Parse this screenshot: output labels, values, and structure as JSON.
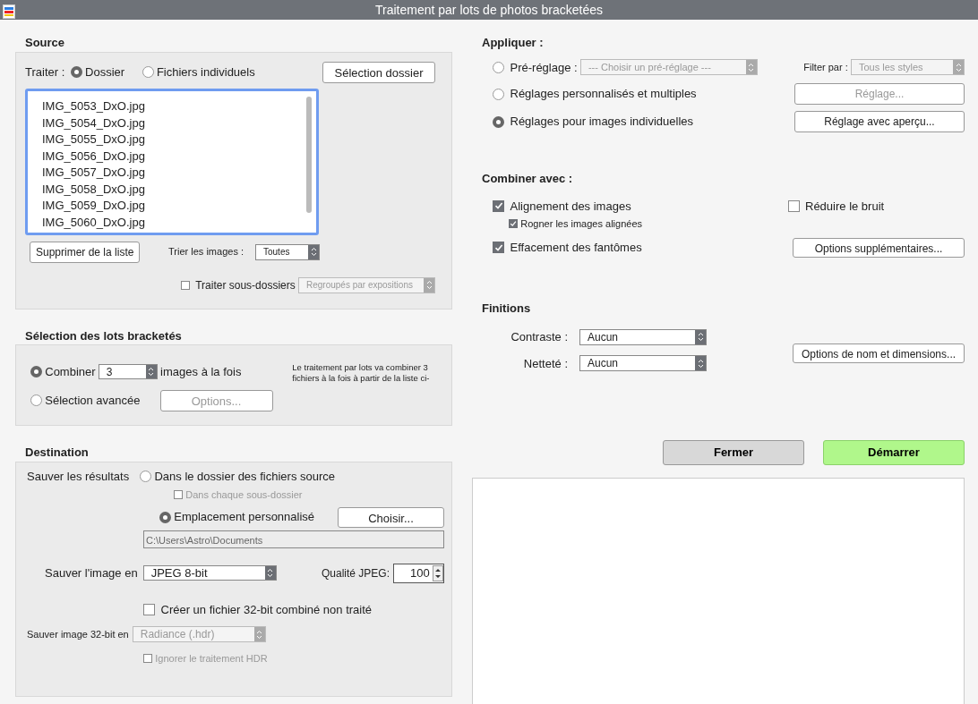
{
  "window": {
    "title": "Traitement par lots de photos bracketées"
  },
  "source": {
    "heading": "Source",
    "process_label": "Traiter :",
    "process_options": [
      {
        "label": "Dossier",
        "selected": true
      },
      {
        "label": "Fichiers individuels",
        "selected": false
      }
    ],
    "folder_button": "Sélection dossier",
    "files": [
      "IMG_5053_DxO.jpg",
      "IMG_5054_DxO.jpg",
      "IMG_5055_DxO.jpg",
      "IMG_5056_DxO.jpg",
      "IMG_5057_DxO.jpg",
      "IMG_5058_DxO.jpg",
      "IMG_5059_DxO.jpg",
      "IMG_5060_DxO.jpg"
    ],
    "remove_button": "Supprimer de la liste",
    "sort_label": "Trier les images :",
    "sort_value": "Toutes",
    "subfolders": {
      "label": "Traiter sous-dossiers",
      "checked": false,
      "value": "Regroupés par expositions",
      "disabled": true
    }
  },
  "batch": {
    "heading": "Sélection des lots bracketés",
    "combine": {
      "label": "Combiner",
      "value": "3",
      "suffix": "images à la fois",
      "selected": true
    },
    "advanced": {
      "label": "Sélection avancée",
      "selected": false,
      "button": "Options...",
      "disabled": true
    },
    "note": "Le traitement par lots va combiner 3 fichiers à la fois à partir de la liste ci-"
  },
  "destination": {
    "heading": "Destination",
    "save_label": "Sauver les résultats",
    "source_folder": {
      "label": "Dans le dossier des fichiers source",
      "selected": false
    },
    "each_subfolder": {
      "label": "Dans chaque sous-dossier",
      "checked": false,
      "disabled": true
    },
    "custom": {
      "label": "Emplacement personnalisé",
      "selected": true
    },
    "choose_button": "Choisir...",
    "path": "C:\\Users\\Astro\\Documents",
    "format_label": "Sauver l'image en",
    "format_value": "JPEG 8-bit",
    "quality_label": "Qualité JPEG:",
    "quality_value": "100",
    "create32": {
      "label": "Créer un fichier 32-bit combiné non traité",
      "checked": false
    },
    "save32_label": "Sauver image 32-bit en",
    "save32_value": "Radiance (.hdr)",
    "save32_disabled": true,
    "ignore_hdr": {
      "label": "Ignorer le traitement HDR",
      "checked": false,
      "disabled": true
    }
  },
  "apply": {
    "heading": "Appliquer :",
    "preset": {
      "label": "Pré-réglage :",
      "selected": false,
      "value": "--- Choisir un pré-réglage ---",
      "disabled": true
    },
    "filter_label": "Filter par :",
    "filter_value": "Tous les styles",
    "filter_disabled": true,
    "custom": {
      "label": "Réglages personnalisés et multiples",
      "selected": false,
      "button": "Réglage...",
      "disabled": true
    },
    "individual": {
      "label": "Réglages pour images individuelles",
      "selected": true,
      "button": "Réglage avec aperçu...",
      "disabled": false
    }
  },
  "combine": {
    "heading": "Combiner avec :",
    "alignment": {
      "label": "Alignement des images",
      "checked": true
    },
    "crop": {
      "label": "Rogner les images alignées",
      "checked": true
    },
    "ghosts": {
      "label": "Effacement des fantômes",
      "checked": true
    },
    "noise": {
      "label": "Réduire le bruit",
      "checked": false
    },
    "more_button": "Options supplémentaires..."
  },
  "finishing": {
    "heading": "Finitions",
    "contrast_label": "Contraste :",
    "contrast_value": "Aucun",
    "sharpness_label": "Netteté :",
    "sharpness_value": "Aucun",
    "naming_button": "Options de nom et dimensions..."
  },
  "close_button": "Fermer",
  "start_button": "Démarrer"
}
